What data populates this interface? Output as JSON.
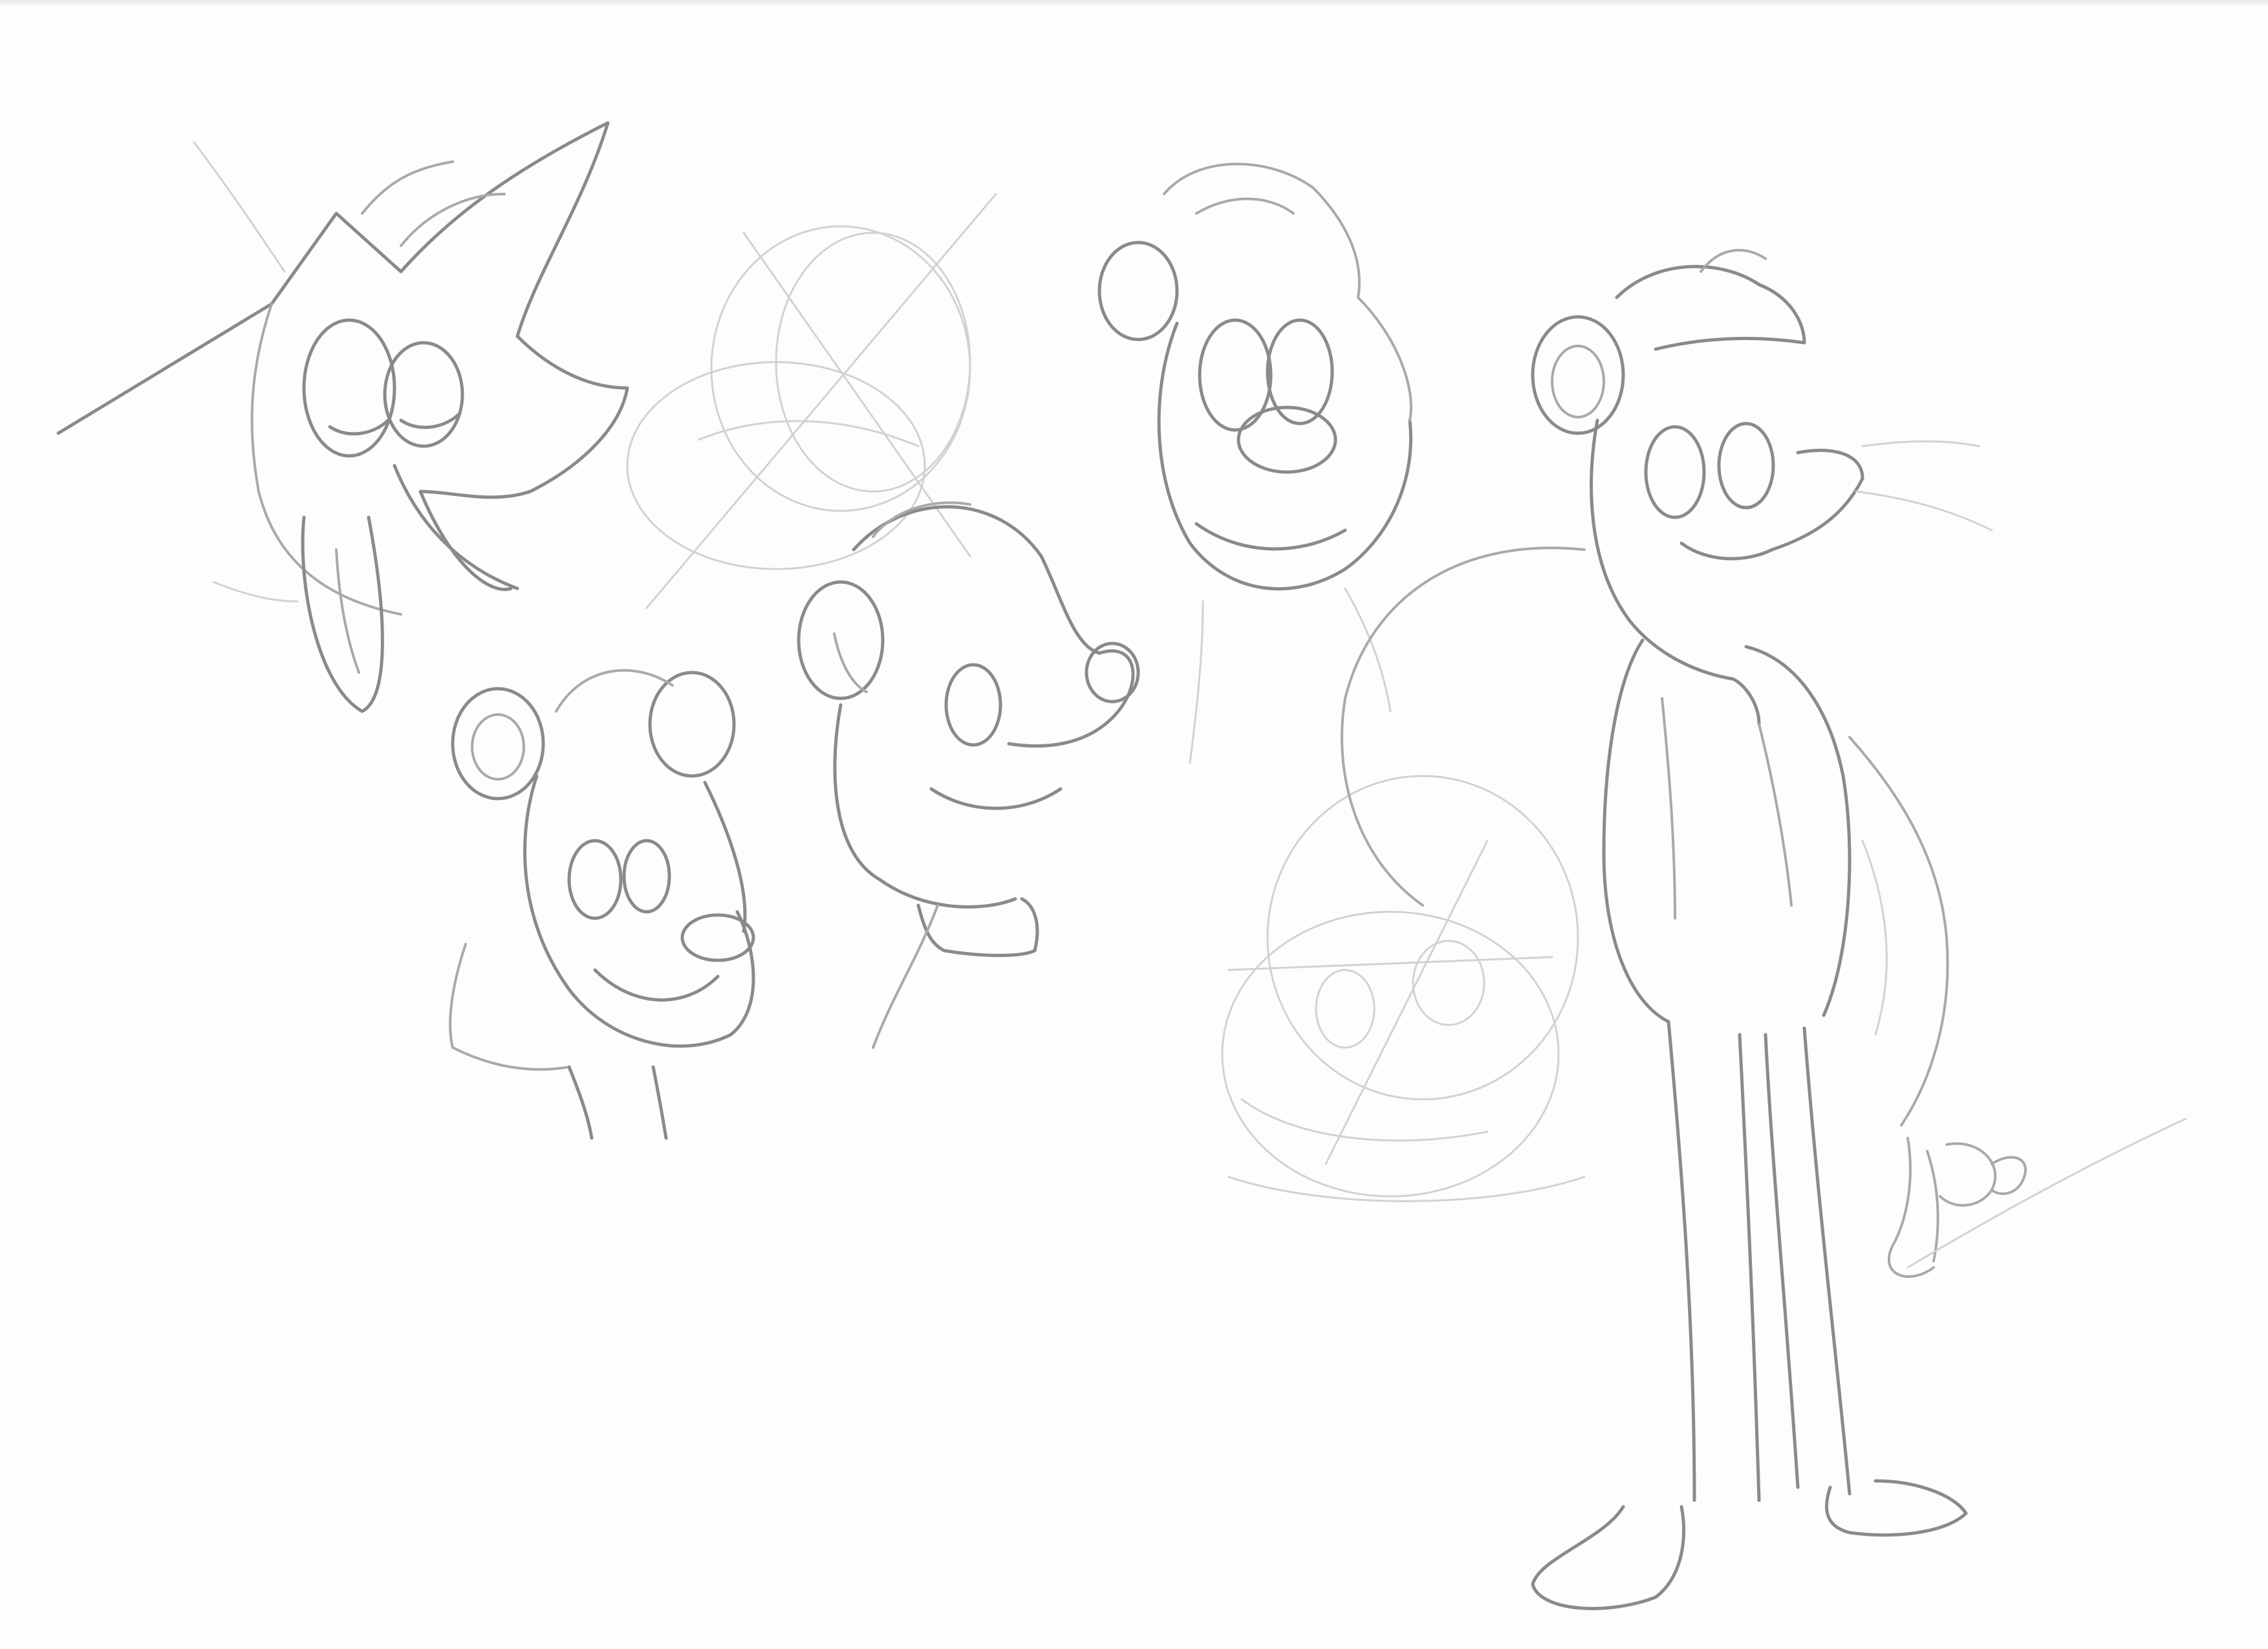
{
  "artwork": {
    "kind": "pencil sketch page",
    "signature_text": "",
    "colors": {
      "paper": "#fdfdfd",
      "line_dark": "#8a8a8a",
      "line_mid": "#a9a9a9",
      "line_light": "#d2d2d2"
    }
  }
}
